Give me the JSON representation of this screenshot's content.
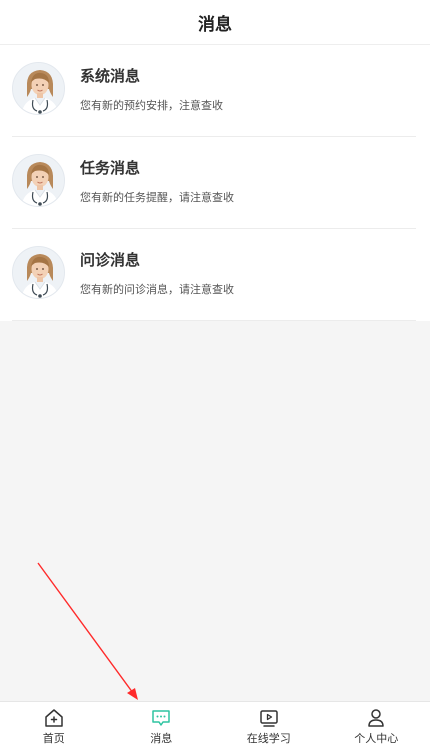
{
  "header": {
    "title": "消息"
  },
  "messages": [
    {
      "title": "系统消息",
      "subtitle": "您有新的预约安排，注意查收",
      "avatar_icon": "doctor-avatar-icon"
    },
    {
      "title": "任务消息",
      "subtitle": "您有新的任务提醒，请注意查收",
      "avatar_icon": "doctor-avatar-icon"
    },
    {
      "title": "问诊消息",
      "subtitle": "您有新的问诊消息，请注意查收",
      "avatar_icon": "doctor-avatar-icon"
    }
  ],
  "tabbar": {
    "items": [
      {
        "label": "首页",
        "icon": "home-icon",
        "active": false
      },
      {
        "label": "消息",
        "icon": "message-icon",
        "active": true
      },
      {
        "label": "在线学习",
        "icon": "video-play-icon",
        "active": false
      },
      {
        "label": "个人中心",
        "icon": "user-icon",
        "active": false
      }
    ],
    "active_color": "#2ec4a0",
    "inactive_color": "#333333"
  },
  "annotation": {
    "arrow_color": "#ff2a2a"
  }
}
